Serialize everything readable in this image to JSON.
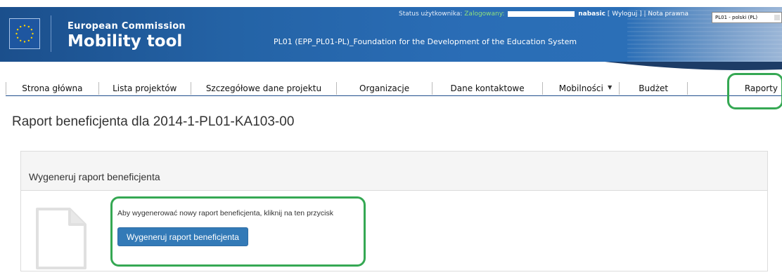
{
  "header": {
    "brand_top": "European Commission",
    "brand_main": "Mobility tool",
    "subtitle": "PL01 (EPP_PL01-PL)_Foundation for the Development of the Education System",
    "status_label": "Status użytkownika:",
    "status_value": "Zalogowany:",
    "username": "nabasic",
    "logout_label": "Wyloguj",
    "legal_label": "Nota prawna",
    "language_selected": "PL01 - polski (PL)",
    "colors": {
      "banner": "#2463a6",
      "status_green": "#8fe07d"
    }
  },
  "nav": {
    "items": [
      {
        "label": "Strona główna"
      },
      {
        "label": "Lista projektów"
      },
      {
        "label": "Szczegółowe dane projektu"
      },
      {
        "label": "Organizacje"
      },
      {
        "label": "Dane kontaktowe"
      },
      {
        "label": "Mobilności"
      },
      {
        "label": "Budżet"
      },
      {
        "label": "Raporty"
      }
    ]
  },
  "page": {
    "title": "Raport beneficjenta dla 2014-1-PL01-KA103-00"
  },
  "panel": {
    "title": "Wygeneruj raport beneficjenta",
    "instruction": "Aby wygenerować nowy raport beneficjenta, kliknij na ten przycisk",
    "button_label": "Wygeneruj raport beneficjenta",
    "icon": "document-icon"
  },
  "colors": {
    "button": "#337ab7",
    "highlight": "#35a853"
  }
}
